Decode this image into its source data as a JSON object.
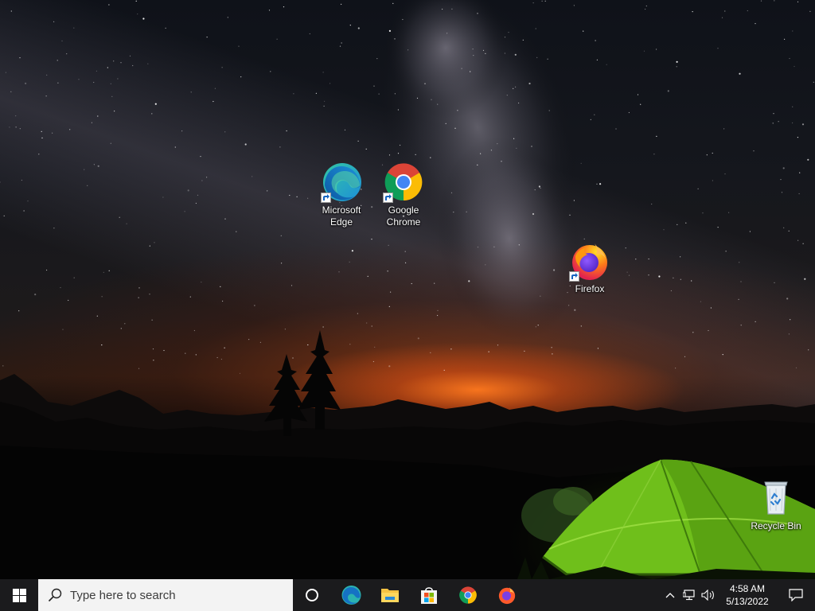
{
  "desktop": {
    "icons": [
      {
        "label": "Microsoft\nEdge",
        "icon": "edge-icon",
        "shortcut": true
      },
      {
        "label": "Google\nChrome",
        "icon": "chrome-icon",
        "shortcut": true
      },
      {
        "label": "Firefox",
        "icon": "firefox-icon",
        "shortcut": true
      },
      {
        "label": "Recycle Bin",
        "icon": "recycle-bin-icon",
        "shortcut": false
      }
    ]
  },
  "taskbar": {
    "start_icon": "windows-logo-icon",
    "search": {
      "placeholder": "Type here to search",
      "icon": "search-icon"
    },
    "cortana_icon": "cortana-circle-icon",
    "pinned_apps": [
      {
        "name": "Microsoft Edge",
        "icon": "edge-icon"
      },
      {
        "name": "File Explorer",
        "icon": "folder-icon"
      },
      {
        "name": "Microsoft Store",
        "icon": "store-icon"
      },
      {
        "name": "Google Chrome",
        "icon": "chrome-icon"
      },
      {
        "name": "Firefox",
        "icon": "firefox-icon"
      }
    ],
    "tray": {
      "icons": [
        "chevron-up-icon",
        "network-icon",
        "volume-icon"
      ],
      "time": "4:58 AM",
      "date": "5/13/2022",
      "notification_icon": "notification-icon"
    },
    "colors": {
      "background": "#1b1b1d",
      "search_background": "#f3f3f3"
    }
  }
}
